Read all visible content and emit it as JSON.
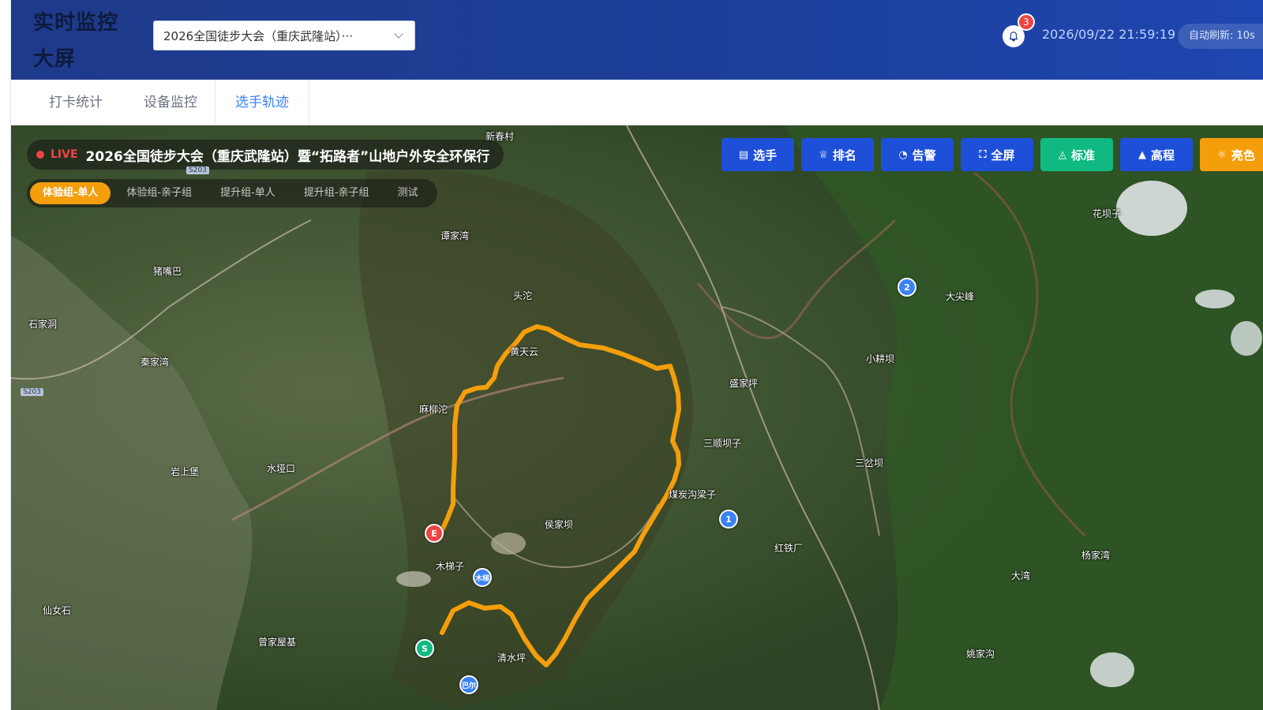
{
  "header": {
    "title": "实时监控大屏",
    "event_select": {
      "value": "2026全国徒步大会（重庆武隆站）···"
    },
    "notifications": {
      "count": "3"
    },
    "datetime": "2026/09/22 21:59:19",
    "auto_refresh": "自动刷新: 10s"
  },
  "tabs": [
    {
      "label": "打卡统计",
      "active": false
    },
    {
      "label": "设备监控",
      "active": false
    },
    {
      "label": "选手轨迹",
      "active": true
    }
  ],
  "map": {
    "live_label": "LIVE",
    "race_title": "2026全国徒步大会（重庆武隆站）暨“拓路者”山地户外安全环保行",
    "groups": [
      {
        "label": "体验组-单人",
        "active": true
      },
      {
        "label": "体验组-亲子组",
        "active": false
      },
      {
        "label": "提升组-单人",
        "active": false
      },
      {
        "label": "提升组-亲子组",
        "active": false
      },
      {
        "label": "测试",
        "active": false
      }
    ],
    "toolbar": [
      {
        "label": "选手",
        "icon": "clipboard-icon",
        "color": "#1e4fd8"
      },
      {
        "label": "排名",
        "icon": "trophy-icon",
        "color": "#1e4fd8"
      },
      {
        "label": "告警",
        "icon": "bell-icon",
        "color": "#1e4fd8"
      },
      {
        "label": "全屏",
        "icon": "expand-icon",
        "color": "#1e4fd8"
      },
      {
        "label": "标准",
        "icon": "map-icon",
        "color": "#10b981"
      },
      {
        "label": "高程",
        "icon": "mountain-icon",
        "color": "#1e4fd8"
      },
      {
        "label": "亮色",
        "icon": "sun-icon",
        "color": "#f59e0b"
      }
    ],
    "places": {
      "xinchuncun": "新春村",
      "tanjiawan": "谭家湾",
      "zhuzuiba": "猪嘴巴",
      "shijiadong": "石家洞",
      "toutuo": "头沱",
      "huangtianyun": "黄天云",
      "qinjiawan": "秦家湾",
      "maliutuo": "麻柳沱",
      "shengjiaping": "盛家坪",
      "sanshunbazi": "三顺坝子",
      "shuiyakou": "水垭口",
      "yanshangbao": "岩上堡",
      "meitangouliangzi": "煤炭沟梁子",
      "houjiaba": "侯家坝",
      "hongtiechang": "红铁厂",
      "mutizi": "木梯子",
      "xiannvshi": "仙女石",
      "zengjiawuji": "曾家屋基",
      "qingshuiping": "清水坪",
      "huabazi": "花坝子",
      "dajianfeng": "大尖峰",
      "xiaogengba": "小耕坝",
      "sanchaba": "三岔坝",
      "yangjiawan": "杨家湾",
      "dawan": "大湾",
      "yaojiagou": "姚家沟"
    },
    "road_tags": [
      "S203",
      "S203"
    ],
    "markers": {
      "cp1": "1",
      "cp2": "2",
      "end": "E",
      "start": "S",
      "mu": "木梯",
      "ba": "巴尔"
    }
  }
}
